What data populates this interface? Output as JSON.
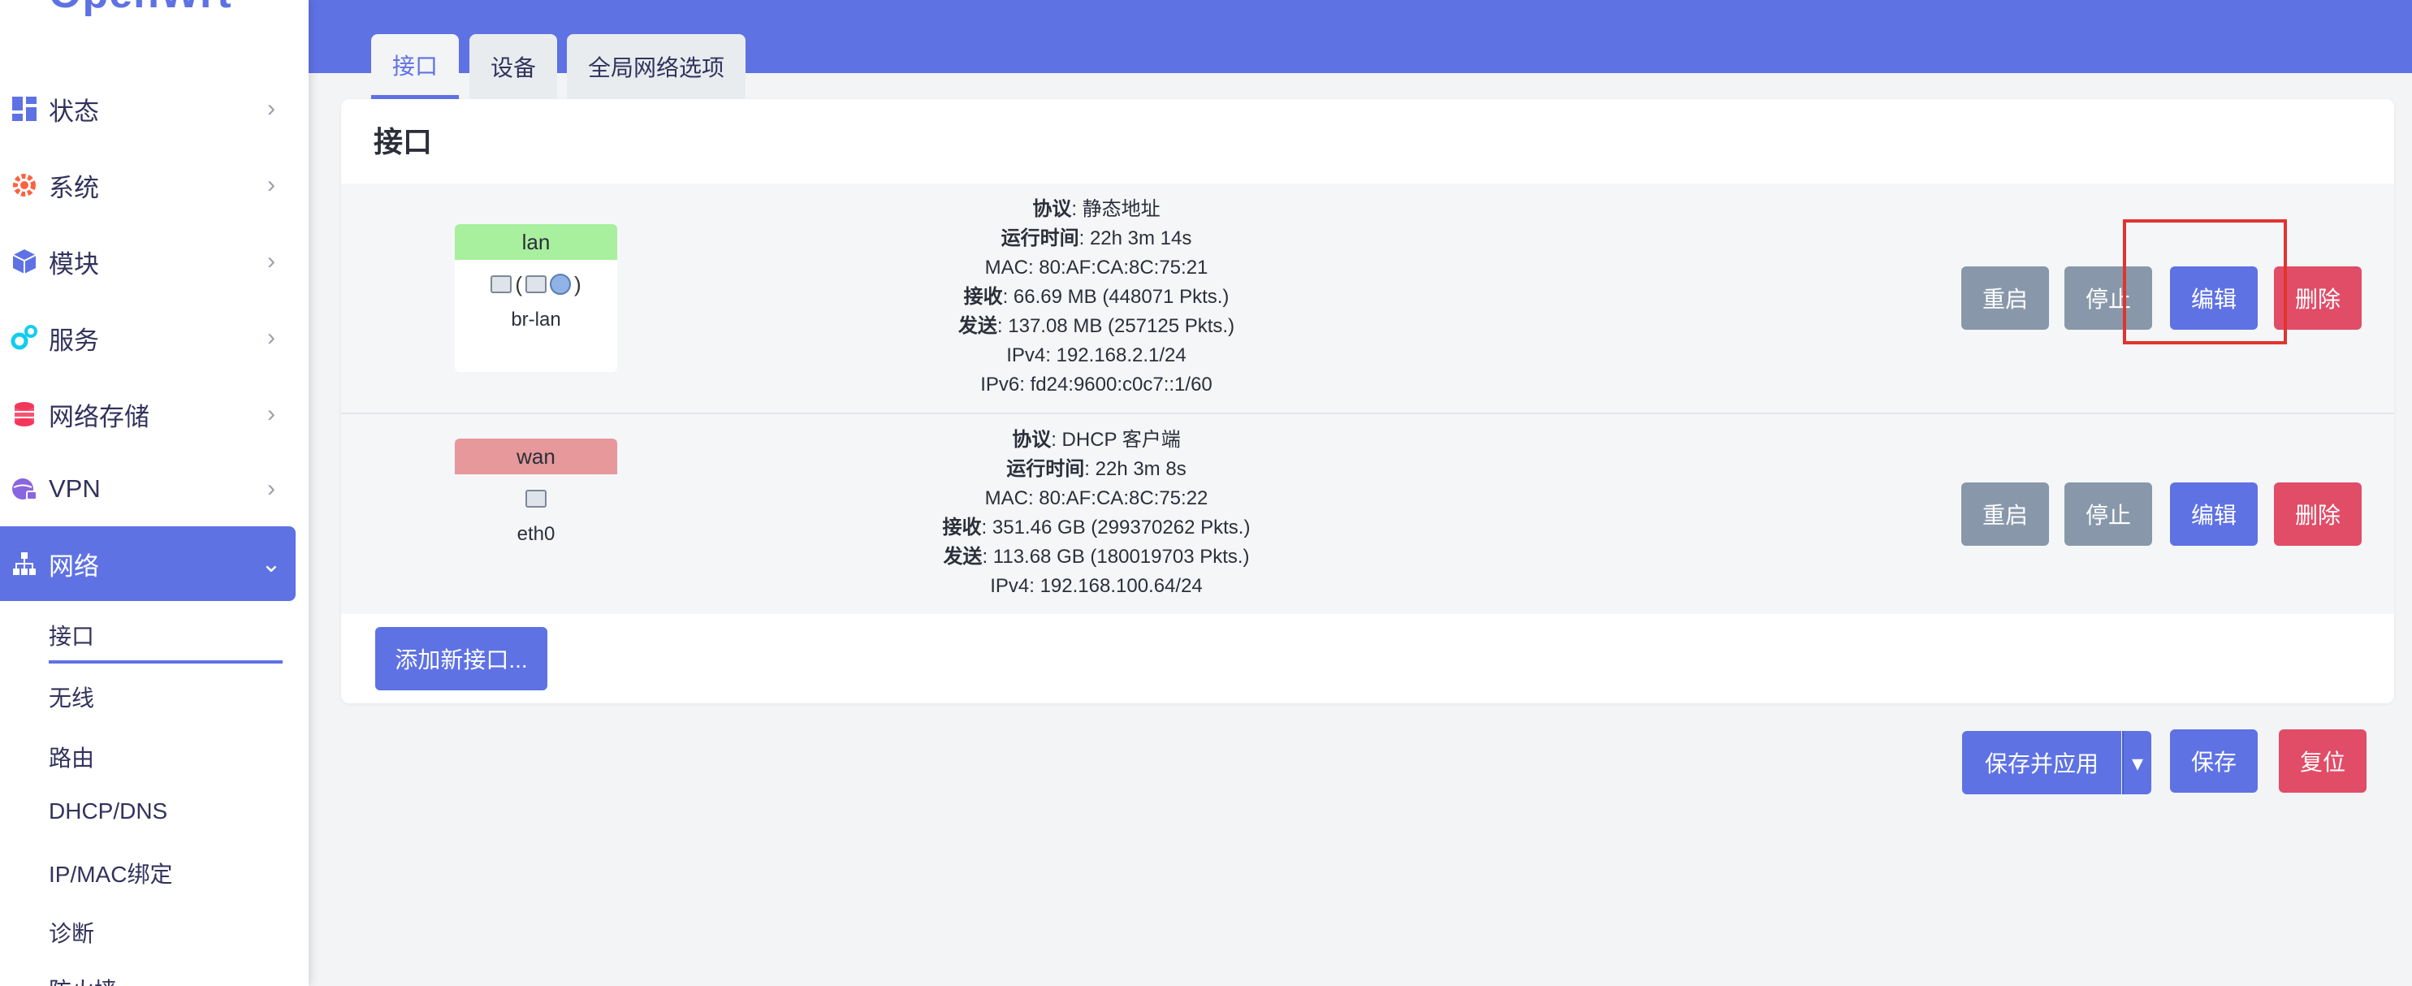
{
  "brand": "OpenWrt",
  "sidebar": {
    "items": [
      {
        "label": "状态",
        "icon": "dashboard-icon",
        "icon_color": "#5e72e4"
      },
      {
        "label": "系统",
        "icon": "gear-icon",
        "icon_color": "#fb6340"
      },
      {
        "label": "模块",
        "icon": "cube-icon",
        "icon_color": "#5e72e4"
      },
      {
        "label": "服务",
        "icon": "cogs-icon",
        "icon_color": "#11cdef"
      },
      {
        "label": "网络存储",
        "icon": "database-icon",
        "icon_color": "#f5365c"
      },
      {
        "label": "VPN",
        "icon": "globe-lock-icon",
        "icon_color": "#8965e0"
      },
      {
        "label": "网络",
        "icon": "network-icon",
        "icon_color": "#ffffff"
      }
    ],
    "sub_items": [
      "接口",
      "无线",
      "路由",
      "DHCP/DNS",
      "IP/MAC绑定",
      "诊断",
      "防火墙"
    ]
  },
  "tabs": [
    "接口",
    "设备",
    "全局网络选项"
  ],
  "card": {
    "title": "接口",
    "interfaces": [
      {
        "name": "lan",
        "device": "br-lan",
        "head_color": "#a8ef9e",
        "icons_text": "(   )",
        "info": [
          {
            "k": "协议",
            "v": "静态地址"
          },
          {
            "k": "运行时间",
            "v": "22h 3m 14s"
          },
          {
            "k": "",
            "v": "MAC: 80:AF:CA:8C:75:21"
          },
          {
            "k": "接收",
            "v": "66.69 MB (448071 Pkts.)"
          },
          {
            "k": "发送",
            "v": "137.08 MB (257125 Pkts.)"
          },
          {
            "k": "",
            "v": "IPv4: 192.168.2.1/24"
          },
          {
            "k": "",
            "v": "IPv6: fd24:9600:c0c7::1/60"
          }
        ]
      },
      {
        "name": "wan",
        "device": "eth0",
        "head_color": "#e6989a",
        "info": [
          {
            "k": "协议",
            "v": "DHCP 客户端"
          },
          {
            "k": "运行时间",
            "v": "22h 3m 8s"
          },
          {
            "k": "",
            "v": "MAC: 80:AF:CA:8C:75:22"
          },
          {
            "k": "接收",
            "v": "351.46 GB (299370262 Pkts.)"
          },
          {
            "k": "发送",
            "v": "113.68 GB (180019703 Pkts.)"
          },
          {
            "k": "",
            "v": "IPv4: 192.168.100.64/24"
          }
        ]
      }
    ],
    "row_buttons": {
      "restart": "重启",
      "stop": "停止",
      "edit": "编辑",
      "delete": "删除"
    },
    "add_button": "添加新接口..."
  },
  "footer": {
    "save_apply": "保存并应用",
    "save": "保存",
    "reset": "复位"
  },
  "colors": {
    "accent": "#5e72e4",
    "danger": "#e14c67",
    "muted": "#8898aa",
    "highlight": "#e0342f"
  }
}
